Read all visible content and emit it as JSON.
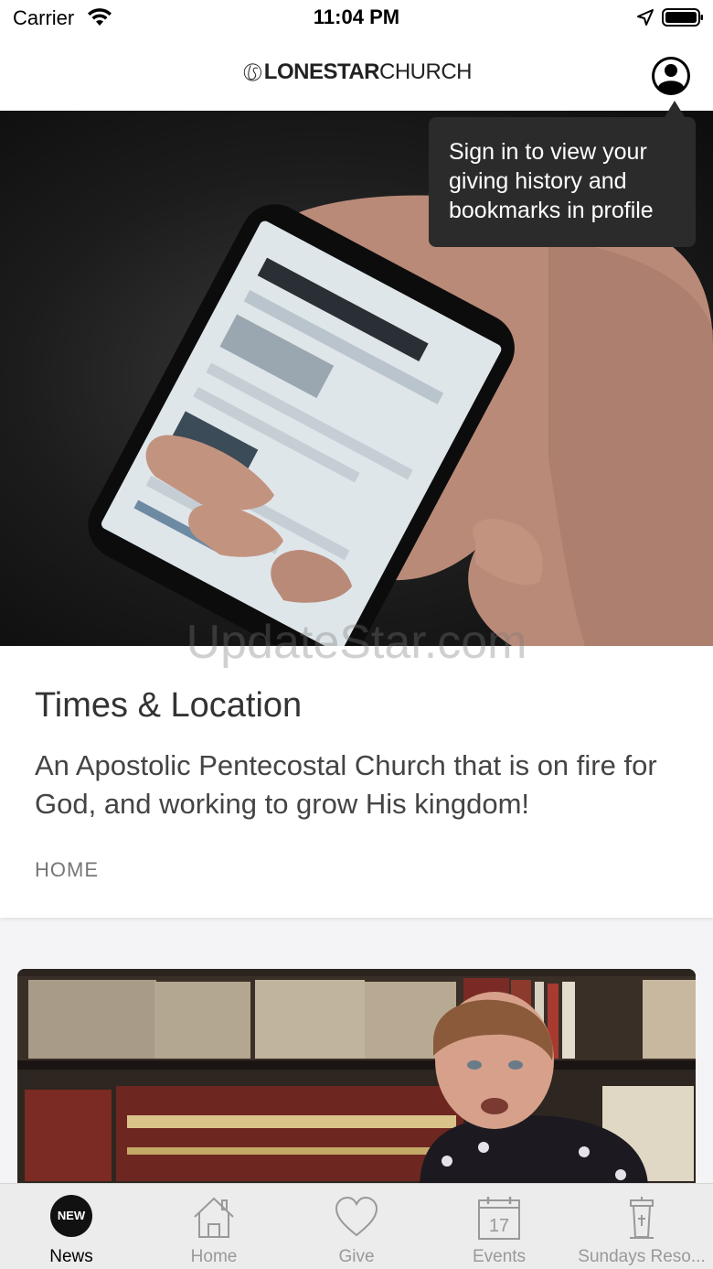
{
  "status_bar": {
    "carrier": "Carrier",
    "time": "11:04 PM"
  },
  "header": {
    "logo_initials": "LS",
    "logo_bold": "LONESTAR",
    "logo_light": "CHURCH"
  },
  "tooltip": {
    "text": "Sign in to view your giving history and bookmarks in profile"
  },
  "watermark": "UpdateStar.com",
  "card": {
    "title": "Times & Location",
    "description": "An Apostolic Pentecostal Church that is on fire for God, and working to grow His kingdom!",
    "category": "HOME"
  },
  "tabs": [
    {
      "label": "News",
      "icon": "new-badge-icon",
      "badge": "NEW",
      "active": true
    },
    {
      "label": "Home",
      "icon": "house-icon",
      "active": false
    },
    {
      "label": "Give",
      "icon": "heart-icon",
      "active": false
    },
    {
      "label": "Events",
      "icon": "calendar-icon",
      "calendar_day": "17",
      "active": false
    },
    {
      "label": "Sundays Reso...",
      "icon": "pulpit-icon",
      "active": false
    }
  ],
  "colors": {
    "tooltip_bg": "#2b2b2b",
    "tab_bar_bg": "#ececec",
    "active_tab": "#000000",
    "inactive_tab": "#999999"
  }
}
